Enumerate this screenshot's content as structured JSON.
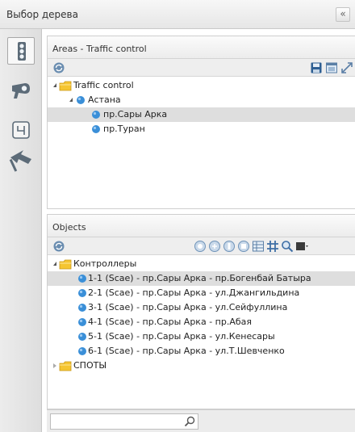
{
  "window": {
    "title": "Выбор дерева",
    "collapse_glyph": "«"
  },
  "sidebar": {
    "items": [
      {
        "name": "traffic-light-icon",
        "active": true
      },
      {
        "name": "camera-icon",
        "active": false
      },
      {
        "name": "road-marking-icon",
        "active": false
      },
      {
        "name": "direction-sign-icon",
        "active": false
      }
    ]
  },
  "areas": {
    "header": "Areas - Traffic control",
    "tree": {
      "root": "Traffic control",
      "city": "Астана",
      "streets": [
        "пр.Сары Арка",
        "пр.Туран"
      ]
    }
  },
  "objects": {
    "header": "Objects",
    "tree": {
      "controllers_label": "Контроллеры",
      "controllers": [
        "1-1 (Scae) - пр.Сары Арка - пр.Богенбай Батыра",
        "2-1 (Scae) - пр.Сары Арка - ул.Джангильдина",
        "3-1 (Scae) - пр.Сары Арка - ул.Сейфуллина",
        "4-1 (Scae) - пр.Сары Арка - пр.Абая",
        "5-1 (Scae) - пр.Сары Арка - ул.Кенесары",
        "6-1 (Scae) - пр.Сары Арка - ул.Т.Шевченко"
      ],
      "spots_label": "СПОТЫ"
    }
  },
  "search": {
    "value": ""
  },
  "colors": {
    "folder": "#f5c531",
    "node": "#3a8fd8",
    "selected_row": "#dedede"
  }
}
